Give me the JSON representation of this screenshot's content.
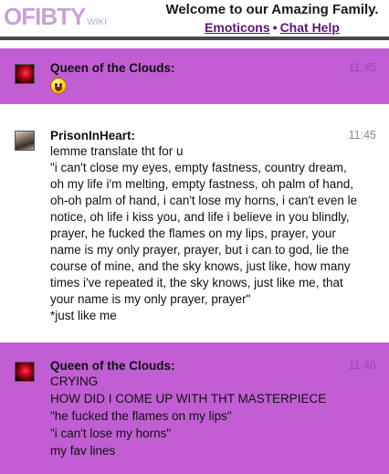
{
  "header": {
    "logo_text": "OFIBTY",
    "logo_suffix": "WIKI",
    "welcome": "Welcome to our Amazing Family.",
    "link_emoticons": "Emoticons",
    "separator": "•",
    "link_chat_help": "Chat Help"
  },
  "messages": [
    {
      "name": "Queen of the Clouds:",
      "time": "11:45",
      "emoticon": "laughing-face-icon"
    },
    {
      "name": "PrisonInHeart:",
      "time": "11:45",
      "lines": [
        "lemme translate tht for u",
        "\"i can't close my eyes, empty fastness, country dream,",
        "oh my life i'm melting, empty fastness, oh palm of hand,",
        "oh-oh palm of hand, i can't lose my horns, i can't even le",
        "notice, oh life i kiss you, and life i believe in you blindly,",
        "prayer, he fucked the flames on my lips, prayer, your",
        "name is my only prayer, prayer, but i can to god, lie the",
        "course of mine, and the sky knows, just like, how many",
        "times i've repeated it, the sky knows, just like me, that",
        "your name is my only prayer, prayer\"",
        "*just like me"
      ]
    },
    {
      "name": "Queen of the Clouds:",
      "time": "11:46",
      "lines": [
        "CRYING",
        "HOW DID I COME UP WITH THT MASTERPIECE",
        "\"he fucked the flames on my lips\"",
        "\"i can't lose my horns\"",
        "my fav lines"
      ]
    }
  ]
}
